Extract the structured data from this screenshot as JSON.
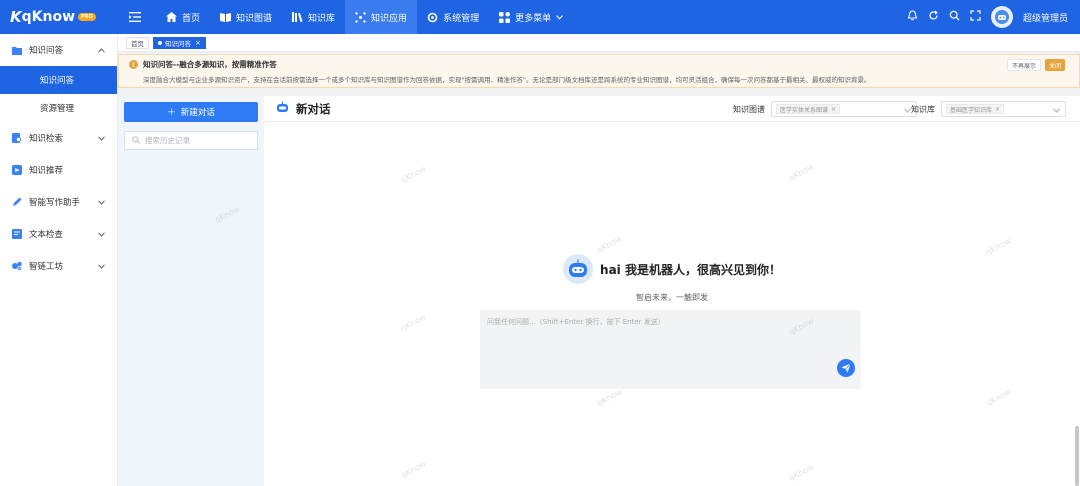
{
  "app": {
    "logo_mark": "K",
    "logo_text": "qKnow",
    "logo_badge": "PRO"
  },
  "top_nav": [
    {
      "label": "首页",
      "icon": "home-icon"
    },
    {
      "label": "知识图谱",
      "icon": "book-icon"
    },
    {
      "label": "知识库",
      "icon": "library-icon"
    },
    {
      "label": "知识应用",
      "icon": "apps-icon",
      "active": true
    },
    {
      "label": "系统管理",
      "icon": "settings-icon"
    },
    {
      "label": "更多菜单",
      "icon": "grid-icon",
      "has_dropdown": true
    }
  ],
  "user": {
    "name": "超级管理员"
  },
  "sidebar": [
    {
      "label": "知识问答",
      "icon": "chat-folder-icon",
      "expanded": true,
      "children": [
        {
          "label": "知识问答",
          "active": true
        },
        {
          "label": "资源管理"
        }
      ]
    },
    {
      "label": "知识检索",
      "icon": "search-doc-icon",
      "expanded": false
    },
    {
      "label": "知识推荐",
      "icon": "recommend-icon"
    },
    {
      "label": "智能写作助手",
      "icon": "pen-icon",
      "expanded": false
    },
    {
      "label": "文本检查",
      "icon": "text-check-icon",
      "expanded": false
    },
    {
      "label": "智链工坊",
      "icon": "workshop-icon",
      "expanded": false
    }
  ],
  "tabs": [
    {
      "label": "首页"
    },
    {
      "label": "知识问答",
      "active": true
    }
  ],
  "notice": {
    "title": "知识问答--融合多源知识，按需精准作答",
    "description": "深度融合大模型与企业多源知识资产，支持在会话前按需选择一个或多个知识库与知识图谱作为回答依据，实现\"按需调用、精准作答\"。无论是部门级文档库还是跨系统的专业知识图谱，均可灵活组合，确保每一次问答都基于最相关、最权威的知识背景。",
    "btn_dismiss": "不再展示",
    "btn_close": "关闭"
  },
  "history": {
    "new_chat_label": "新建对话",
    "search_placeholder": "搜索历史记录"
  },
  "chat": {
    "title": "新对话",
    "kg_label": "知识图谱",
    "kg_selected": "医学实体关系图谱",
    "kb_label": "知识库",
    "kb_selected": "基础医学知识库",
    "welcome": "hai 我是机器人，很高兴见到你！",
    "subtitle": "智启未来，一触即发",
    "input_placeholder": "问我任何问题...（Shift+Enter 换行，按下 Enter 发送）"
  },
  "watermark": "qKnow",
  "colors": {
    "primary": "#1f64e3",
    "accent": "#2f7bf5",
    "warning": "#e6a23c"
  }
}
